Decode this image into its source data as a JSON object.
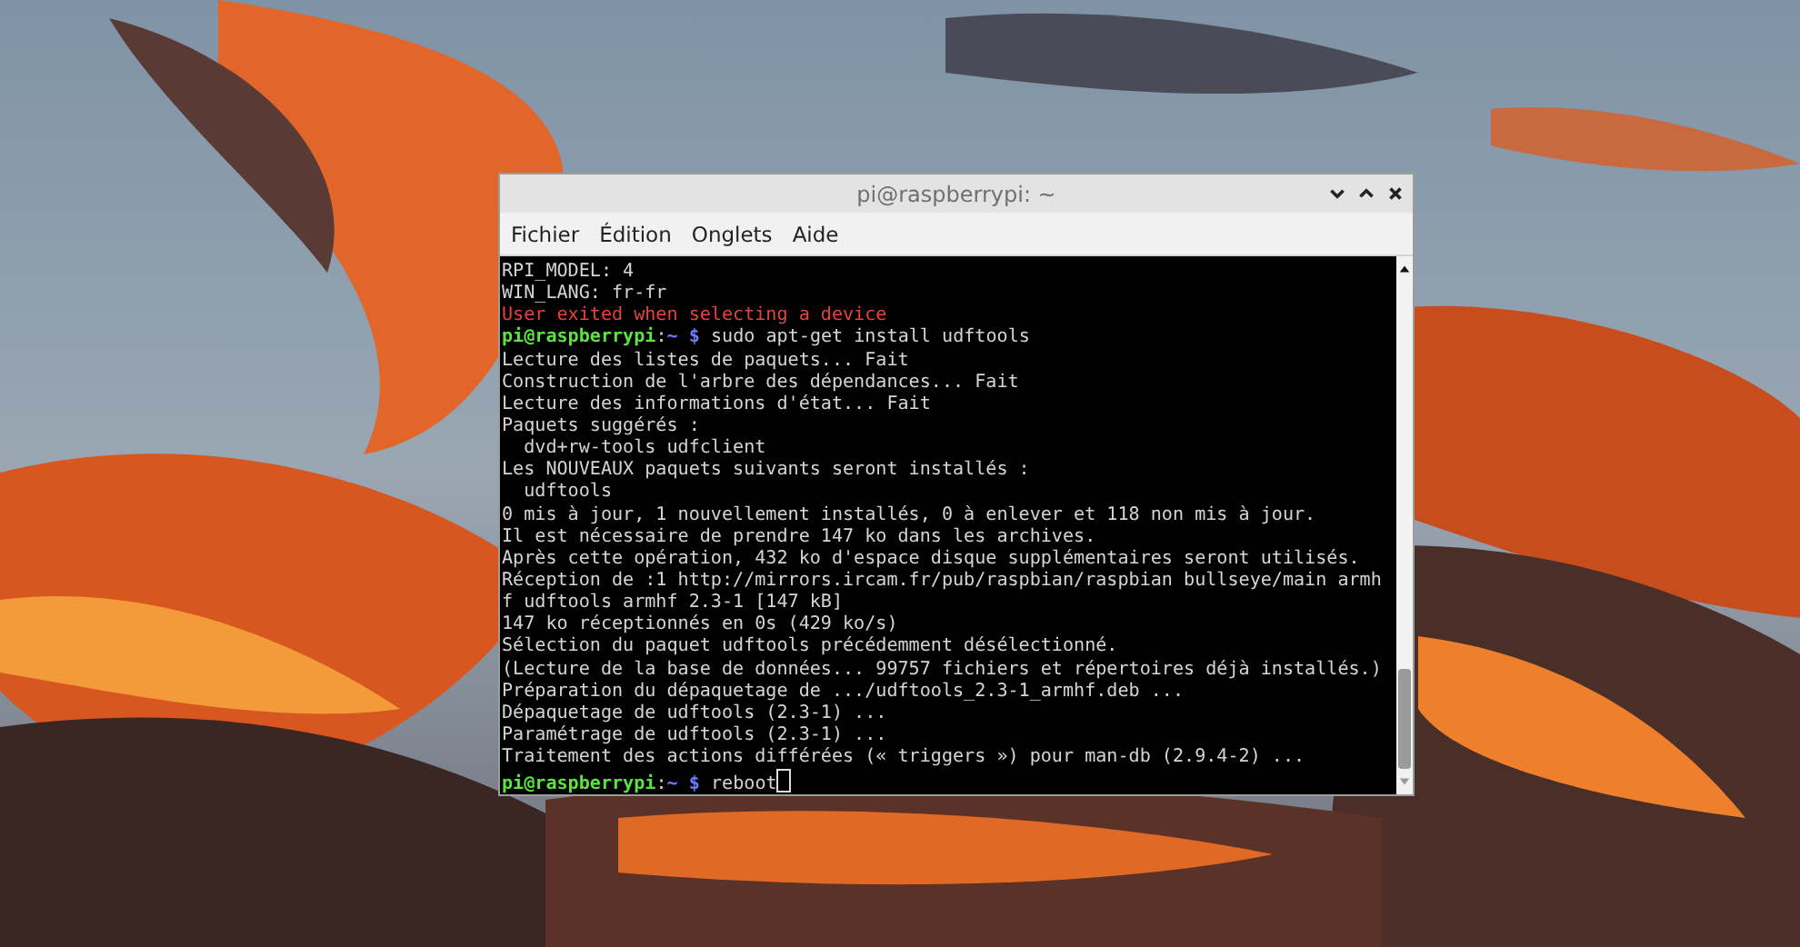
{
  "window": {
    "title": "pi@raspberrypi: ~"
  },
  "menu": [
    {
      "label": "Fichier"
    },
    {
      "label": "Édition"
    },
    {
      "label": "Onglets"
    },
    {
      "label": "Aide"
    }
  ],
  "terminal": {
    "lines": [
      {
        "kind": "plain",
        "text": "RPI_MODEL: 4"
      },
      {
        "kind": "plain",
        "text": "WIN_LANG: fr-fr"
      },
      {
        "kind": "error",
        "text": "User exited when selecting a device"
      },
      {
        "kind": "prompt",
        "user": "pi@raspberrypi",
        "separator": ":",
        "path": "~",
        "symbol": "$",
        "command": "sudo apt-get install udftools",
        "cursor": false
      },
      {
        "kind": "plain",
        "text": "Lecture des listes de paquets... Fait"
      },
      {
        "kind": "plain",
        "text": "Construction de l'arbre des dépendances... Fait"
      },
      {
        "kind": "plain",
        "text": "Lecture des informations d'état... Fait"
      },
      {
        "kind": "plain",
        "text": "Paquets suggérés :"
      },
      {
        "kind": "plain",
        "text": "  dvd+rw-tools udfclient"
      },
      {
        "kind": "plain",
        "text": "Les NOUVEAUX paquets suivants seront installés :"
      },
      {
        "kind": "plain",
        "text": "  udftools"
      },
      {
        "kind": "plain",
        "text": "0 mis à jour, 1 nouvellement installés, 0 à enlever et 118 non mis à jour."
      },
      {
        "kind": "plain",
        "text": "Il est nécessaire de prendre 147 ko dans les archives."
      },
      {
        "kind": "plain",
        "text": "Après cette opération, 432 ko d'espace disque supplémentaires seront utilisés."
      },
      {
        "kind": "plain",
        "text": "Réception de :1 http://mirrors.ircam.fr/pub/raspbian/raspbian bullseye/main armh"
      },
      {
        "kind": "plain",
        "text": "f udftools armhf 2.3-1 [147 kB]"
      },
      {
        "kind": "plain",
        "text": "147 ko réceptionnés en 0s (429 ko/s)"
      },
      {
        "kind": "plain",
        "text": "Sélection du paquet udftools précédemment désélectionné."
      },
      {
        "kind": "plain",
        "text": "(Lecture de la base de données... 99757 fichiers et répertoires déjà installés.)"
      },
      {
        "kind": "plain",
        "text": "Préparation du dépaquetage de .../udftools_2.3-1_armhf.deb ..."
      },
      {
        "kind": "plain",
        "text": "Dépaquetage de udftools (2.3-1) ..."
      },
      {
        "kind": "plain",
        "text": "Paramétrage de udftools (2.3-1) ..."
      },
      {
        "kind": "plain",
        "text": "Traitement des actions différées (« triggers ») pour man-db (2.9.4-2) ..."
      },
      {
        "kind": "prompt",
        "user": "pi@raspberrypi",
        "separator": ":",
        "path": "~",
        "symbol": "$",
        "command": "reboot",
        "cursor": true
      }
    ]
  }
}
